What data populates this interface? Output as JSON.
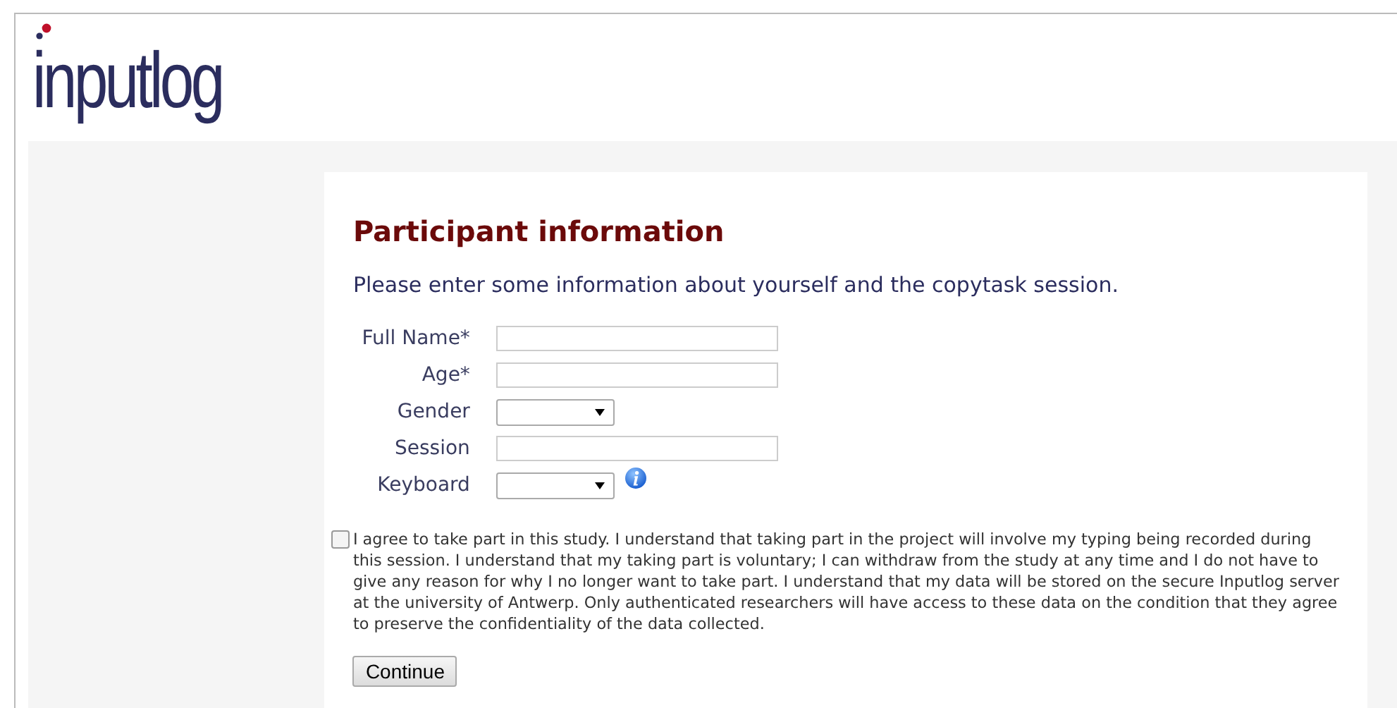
{
  "logo": {
    "text": "inputlog"
  },
  "form": {
    "title": "Participant information",
    "intro": "Please enter some information about yourself and the copytask session.",
    "fields": [
      {
        "label": "Full Name*",
        "kind": "text"
      },
      {
        "label": "Age*",
        "kind": "text"
      },
      {
        "label": "Gender",
        "kind": "select"
      },
      {
        "label": "Session",
        "kind": "text"
      },
      {
        "label": "Keyboard",
        "kind": "select",
        "info": true
      }
    ],
    "consent": {
      "checked": false,
      "text": "I agree to take part in this study. I understand that taking part in the project will involve my typing being recorded during this session. I understand that my taking part is voluntary; I can withdraw from the study at any time and I do not have to give any reason for why I no longer want to take part. I understand that my data will be stored on the secure Inputlog server at the university of Antwerp. Only authenticated researchers will have access to these data on the condition that they agree to preserve the confidentiality of the data collected."
    },
    "button": "Continue"
  }
}
